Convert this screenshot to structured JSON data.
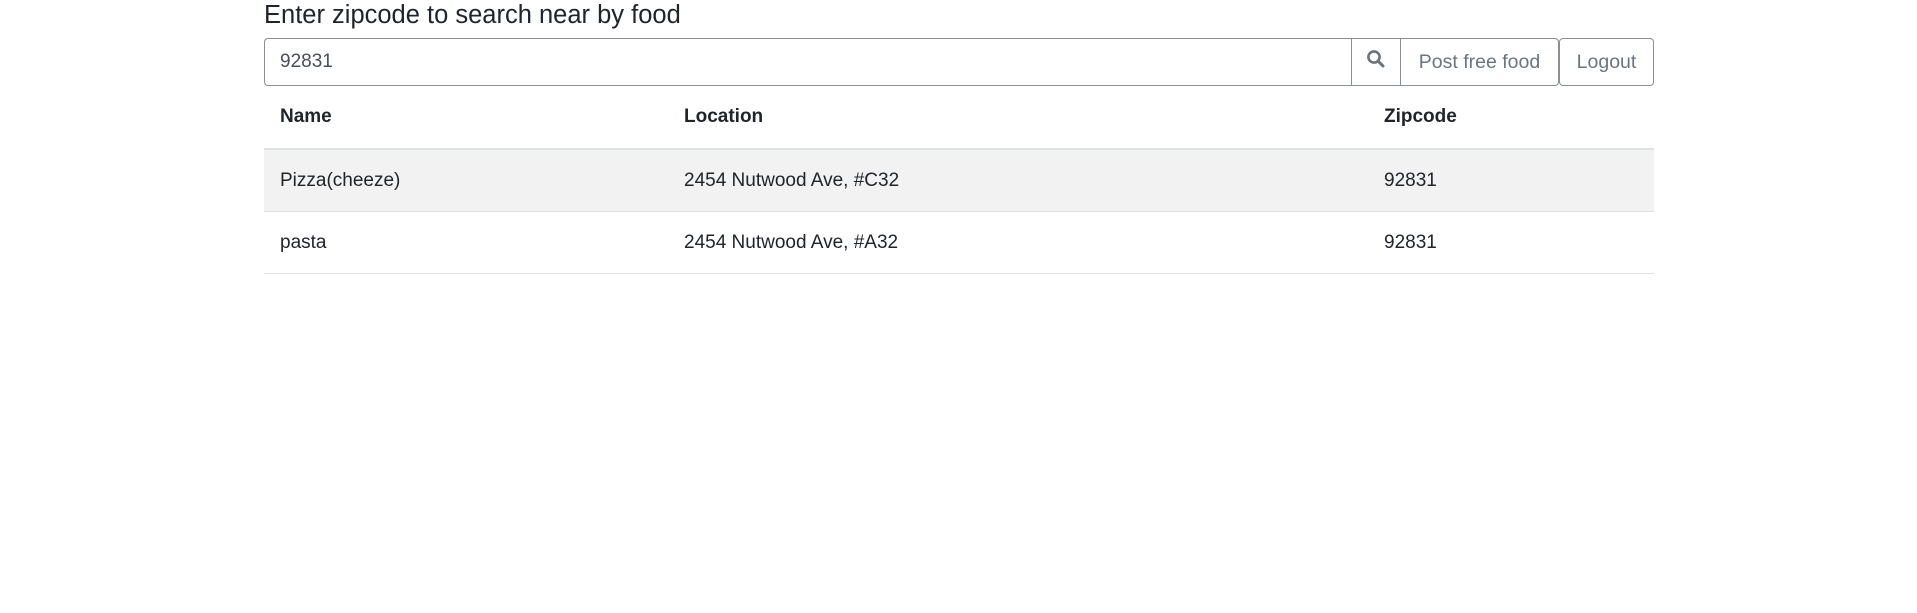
{
  "page": {
    "heading": "Enter zipcode to search near by food"
  },
  "search": {
    "value": "92831",
    "icon": "search-icon"
  },
  "buttons": {
    "post_label": "Post free food",
    "logout_label": "Logout"
  },
  "table": {
    "headers": [
      "Name",
      "Location",
      "Zipcode"
    ],
    "rows": [
      {
        "name": "Pizza(cheeze)",
        "location": "2454 Nutwood Ave, #C32",
        "zipcode": "92831"
      },
      {
        "name": "pasta",
        "location": "2454 Nutwood Ave, #A32",
        "zipcode": "92831"
      }
    ]
  },
  "colors": {
    "stripe": "#f2f2f2",
    "border": "#8a8f94",
    "muted_text": "#6c757d"
  }
}
